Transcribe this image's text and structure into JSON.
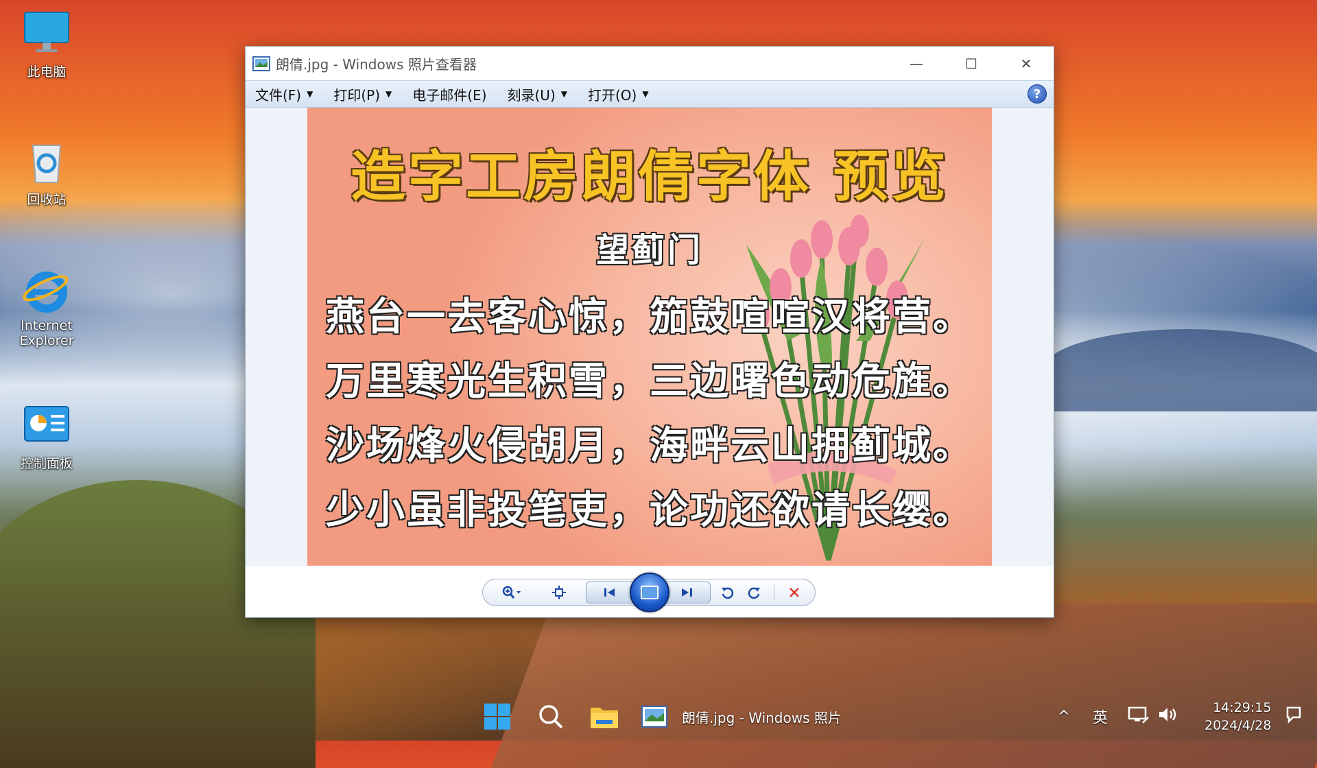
{
  "desktop": {
    "icons": [
      {
        "label": "此电脑",
        "icon": "computer-icon"
      },
      {
        "label": "回收站",
        "icon": "recycle-bin-icon"
      },
      {
        "label": "Internet Explorer",
        "icon": "internet-explorer-icon"
      },
      {
        "label": "控制面板",
        "icon": "control-panel-icon"
      }
    ]
  },
  "window": {
    "title": "朗倩.jpg - Windows 照片查看器",
    "controls": {
      "minimize": "—",
      "maximize": "☐",
      "close": "✕"
    },
    "menu": [
      {
        "label": "文件(F)",
        "has_dropdown": true
      },
      {
        "label": "打印(P)",
        "has_dropdown": true
      },
      {
        "label": "电子邮件(E)",
        "has_dropdown": false
      },
      {
        "label": "刻录(U)",
        "has_dropdown": true
      },
      {
        "label": "打开(O)",
        "has_dropdown": true
      }
    ],
    "help_label": "?",
    "photo": {
      "title": "造字工房朗倩字体 预览",
      "poem_title": "望蓟门",
      "lines": [
        "燕台一去客心惊，笳鼓喧喧汉将营。",
        "万里寒光生积雪，三边曙色动危旌。",
        "沙场烽火侵胡月，海畔云山拥蓟城。",
        "少小虽非投笔吏，论功还欲请长缨。"
      ]
    },
    "toolbar": {
      "zoom": "zoom-icon",
      "actual_size": "fit-window-icon",
      "previous": "previous-icon",
      "slideshow": "slideshow-icon",
      "next": "next-icon",
      "rotate_left": "rotate-counterclockwise-icon",
      "rotate_right": "rotate-clockwise-icon",
      "delete": "delete-icon"
    }
  },
  "taskbar": {
    "app_label": "朗倩.jpg - Windows 照片",
    "tray": {
      "chevron": "^",
      "ime": "英",
      "time": "14:29:15",
      "date": "2024/4/28"
    }
  },
  "colors": {
    "accent": "#1c4aa8",
    "title_yellow": "#f7c325",
    "menubar": "#dbe6f5",
    "delete_red": "#d83a2a"
  }
}
